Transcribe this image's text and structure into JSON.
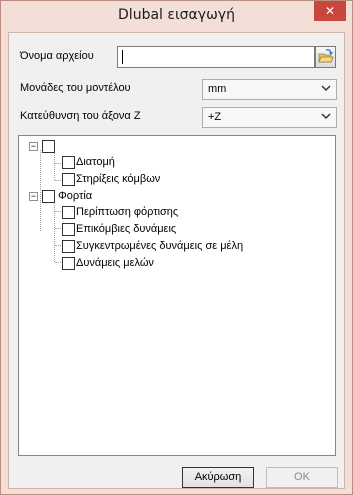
{
  "window": {
    "title": "Dlubal εισαγωγή",
    "close_label": "✕"
  },
  "form": {
    "filename_label": "Όνομα αρχείου",
    "filename_value": "",
    "units_label": "Μονάδες του μοντέλου",
    "units_value": "mm",
    "z_axis_label": "Κατεύθυνση του άξονα Z",
    "z_axis_value": "+Z"
  },
  "tree": {
    "root1": {
      "label": "",
      "children": [
        "Διατομή",
        "Στηρίξεις κόμβων"
      ]
    },
    "root2": {
      "label": "Φορτία",
      "children": [
        "Περίπτωση φόρτισης",
        "Επικόμβιες δυνάμεις",
        "Συγκεντρωμένες δυνάμεις σε μέλη",
        "Δυνάμεις μελών"
      ]
    },
    "expander_glyph": "−"
  },
  "buttons": {
    "cancel": "Ακύρωση",
    "ok": "OK"
  },
  "icons": {
    "browse": "folder-open-icon",
    "dropdown": "chevron-down-icon",
    "close": "close-icon"
  },
  "colors": {
    "frame": "#f3dfd8",
    "close": "#c7473d"
  }
}
